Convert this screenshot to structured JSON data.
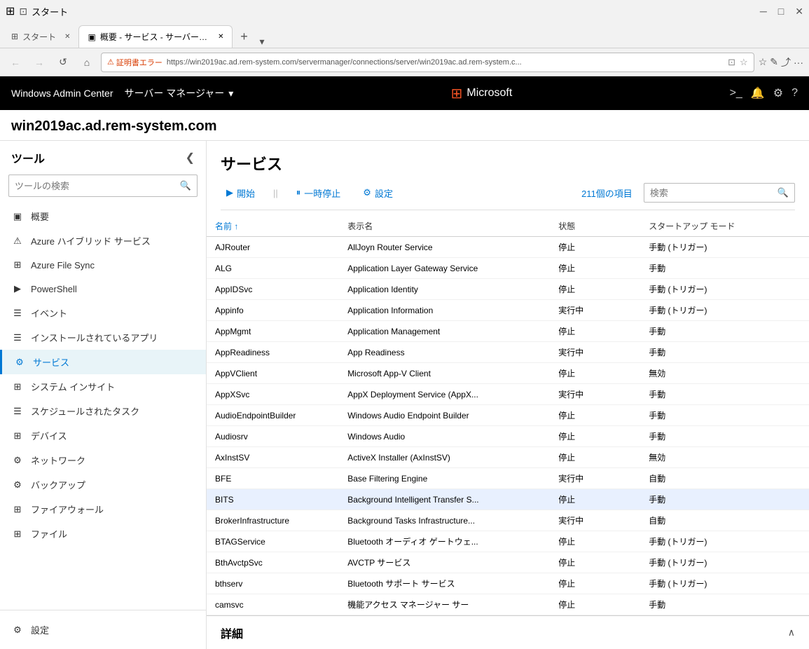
{
  "browser": {
    "title_icon": "⊞",
    "start_label": "スタート",
    "tab1_icon": "▣",
    "tab1_label": "概要 - サービス - サーバー マ",
    "tab_close": "✕",
    "tab_add": "+",
    "nav_back": "←",
    "nav_forward": "→",
    "nav_refresh": "↺",
    "nav_home": "⌂",
    "cert_error_icon": "⚠",
    "cert_error_label": "証明書エラー",
    "address_url": "https://win2019ac.ad.rem-system.com/servermanager/connections/server/win2019ac.ad.rem-system.c...",
    "fav_icon": "☆",
    "fav_icon2": "☆",
    "pen_icon": "✎",
    "share_icon": "⤴",
    "more_icon": "···"
  },
  "app_header": {
    "title": "Windows Admin Center",
    "server_manager_label": "サーバー マネージャー",
    "server_manager_chevron": "▾",
    "ms_logo": "⊞",
    "ms_label": "Microsoft",
    "terminal_icon": ">_",
    "bell_icon": "🔔",
    "gear_icon": "⚙",
    "help_icon": "?"
  },
  "server": {
    "title": "win2019ac.ad.rem-system.com"
  },
  "sidebar": {
    "title": "ツール",
    "collapse_icon": "❮",
    "search_placeholder": "ツールの検索",
    "search_icon": "🔍",
    "items": [
      {
        "id": "overview",
        "label": "概要",
        "icon": "▣"
      },
      {
        "id": "azure-hybrid",
        "label": "Azure ハイブリッド サービス",
        "icon": "⚠"
      },
      {
        "id": "azure-file-sync",
        "label": "Azure File Sync",
        "icon": "⊞"
      },
      {
        "id": "powershell",
        "label": "PowerShell",
        "icon": "▶"
      },
      {
        "id": "events",
        "label": "イベント",
        "icon": "☰"
      },
      {
        "id": "installed-apps",
        "label": "インストールされているアプリ",
        "icon": "☰"
      },
      {
        "id": "services",
        "label": "サービス",
        "icon": "⚙",
        "active": true
      },
      {
        "id": "system-insight",
        "label": "システム インサイト",
        "icon": "⊞"
      },
      {
        "id": "scheduled-tasks",
        "label": "スケジュールされたタスク",
        "icon": "☰"
      },
      {
        "id": "devices",
        "label": "デバイス",
        "icon": "⊞"
      },
      {
        "id": "network",
        "label": "ネットワーク",
        "icon": "⚙"
      },
      {
        "id": "backup",
        "label": "バックアップ",
        "icon": "⚙"
      },
      {
        "id": "firewall",
        "label": "ファイアウォール",
        "icon": "⊞"
      },
      {
        "id": "files",
        "label": "ファイル",
        "icon": "⊞"
      }
    ],
    "settings_label": "設定",
    "settings_icon": "⚙"
  },
  "content": {
    "title": "サービス",
    "toolbar": {
      "start_label": "開始",
      "start_icon": "▶",
      "pause_label": "一時停止",
      "pause_icon": "⏸",
      "settings_label": "設定",
      "settings_icon": "⚙"
    },
    "item_count": "211個の項目",
    "search_placeholder": "検索",
    "search_icon": "🔍",
    "table_headers": {
      "name": "名前",
      "name_sort": "↑",
      "display_name": "表示名",
      "status": "状態",
      "startup_mode": "スタートアップ モード"
    },
    "services": [
      {
        "name": "AJRouter",
        "display_name": "AllJoyn Router Service",
        "status": "停止",
        "startup": "手動 (トリガー)",
        "selected": false
      },
      {
        "name": "ALG",
        "display_name": "Application Layer Gateway Service",
        "status": "停止",
        "startup": "手動",
        "selected": false
      },
      {
        "name": "AppIDSvc",
        "display_name": "Application Identity",
        "status": "停止",
        "startup": "手動 (トリガー)",
        "selected": false
      },
      {
        "name": "Appinfo",
        "display_name": "Application Information",
        "status": "実行中",
        "startup": "手動 (トリガー)",
        "selected": false
      },
      {
        "name": "AppMgmt",
        "display_name": "Application Management",
        "status": "停止",
        "startup": "手動",
        "selected": false
      },
      {
        "name": "AppReadiness",
        "display_name": "App Readiness",
        "status": "実行中",
        "startup": "手動",
        "selected": false
      },
      {
        "name": "AppVClient",
        "display_name": "Microsoft App-V Client",
        "status": "停止",
        "startup": "無効",
        "selected": false
      },
      {
        "name": "AppXSvc",
        "display_name": "AppX Deployment Service (AppX...",
        "status": "実行中",
        "startup": "手動",
        "selected": false
      },
      {
        "name": "AudioEndpointBuilder",
        "display_name": "Windows Audio Endpoint Builder",
        "status": "停止",
        "startup": "手動",
        "selected": false
      },
      {
        "name": "Audiosrv",
        "display_name": "Windows Audio",
        "status": "停止",
        "startup": "手動",
        "selected": false
      },
      {
        "name": "AxInstSV",
        "display_name": "ActiveX Installer (AxInstSV)",
        "status": "停止",
        "startup": "無効",
        "selected": false
      },
      {
        "name": "BFE",
        "display_name": "Base Filtering Engine",
        "status": "実行中",
        "startup": "自動",
        "selected": false
      },
      {
        "name": "BITS",
        "display_name": "Background Intelligent Transfer S...",
        "status": "停止",
        "startup": "手動",
        "selected": true
      },
      {
        "name": "BrokerInfrastructure",
        "display_name": "Background Tasks Infrastructure...",
        "status": "実行中",
        "startup": "自動",
        "selected": false
      },
      {
        "name": "BTAGService",
        "display_name": "Bluetooth オーディオ ゲートウェ...",
        "status": "停止",
        "startup": "手動 (トリガー)",
        "selected": false
      },
      {
        "name": "BthAvctpSvc",
        "display_name": "AVCTP サービス",
        "status": "停止",
        "startup": "手動 (トリガー)",
        "selected": false
      },
      {
        "name": "bthserv",
        "display_name": "Bluetooth サポート サービス",
        "status": "停止",
        "startup": "手動 (トリガー)",
        "selected": false
      },
      {
        "name": "camsvc",
        "display_name": "機能アクセス マネージャー サー",
        "status": "停止",
        "startup": "手動",
        "selected": false
      }
    ]
  },
  "details": {
    "title": "詳細",
    "chevron": "∧"
  }
}
